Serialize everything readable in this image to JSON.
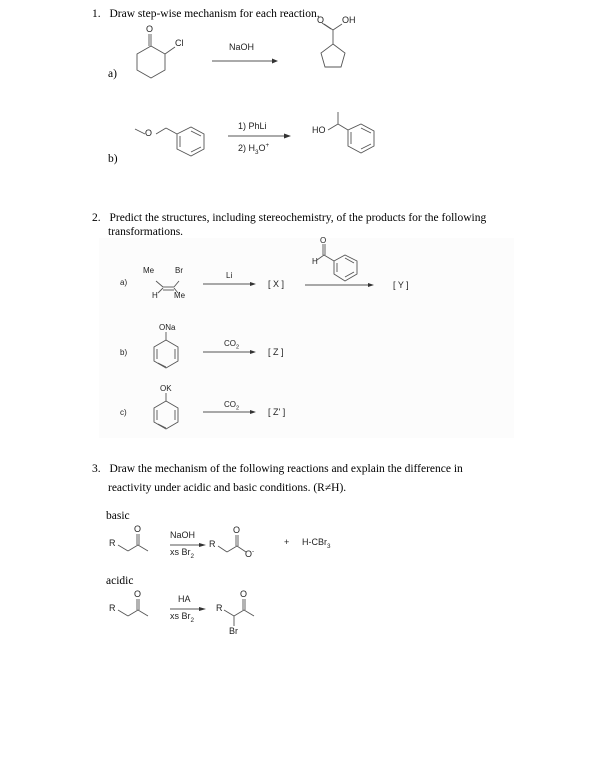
{
  "q1": {
    "number": "1.",
    "text": "Draw step-wise mechanism for each reaction.",
    "a": {
      "label": "a)",
      "reactant_sub": "Cl",
      "reactant_o": "O",
      "reagent": "NaOH",
      "product_o": "O",
      "product_oh": "OH"
    },
    "b": {
      "label": "b)",
      "reactant_o": "O",
      "reagent_1": "1) PhLi",
      "reagent_2_prefix": "2) H",
      "reagent_2_sub": "3",
      "reagent_2_mid": "O",
      "reagent_2_sup": "+",
      "product_ho": "HO"
    }
  },
  "q2": {
    "number": "2.",
    "text_line1": "Predict the structures, including stereochemistry, of the products for the following",
    "text_line2": "transformations.",
    "a": {
      "label": "a)",
      "sub_me_top": "Me",
      "sub_br": "Br",
      "sub_h": "H",
      "sub_me_bottom": "Me",
      "reagent": "Li",
      "intermediate": "[ X ]",
      "aldehyde_o": "O",
      "aldehyde_h": "H",
      "product": "[ Y ]"
    },
    "b": {
      "label": "b)",
      "substituent": "ONa",
      "reagent_prefix": "CO",
      "reagent_sub": "2",
      "product": "[ Z ]"
    },
    "c": {
      "label": "c)",
      "substituent": "OK",
      "reagent_prefix": "CO",
      "reagent_sub": "2",
      "product": "[ Z' ]"
    }
  },
  "q3": {
    "number": "3.",
    "text_line1": "Draw the mechanism of the following reactions and explain the difference in",
    "text_line2": "reactivity under acidic and basic conditions. (R≠H).",
    "basic": {
      "label": "basic",
      "r": "R",
      "o": "O",
      "reagent_top": "NaOH",
      "reagent_bottom_prefix": "xs Br",
      "reagent_bottom_sub": "2",
      "product_r": "R",
      "product_o": "O",
      "product_o_minus": "O",
      "minus": "-",
      "plus": "+",
      "byproduct_prefix": "H-CBr",
      "byproduct_sub": "3"
    },
    "acidic": {
      "label": "acidic",
      "r": "R",
      "o": "O",
      "reagent_top": "HA",
      "reagent_bottom_prefix": "xs Br",
      "reagent_bottom_sub": "2",
      "product_r": "R",
      "product_o": "O",
      "product_br": "Br"
    }
  }
}
